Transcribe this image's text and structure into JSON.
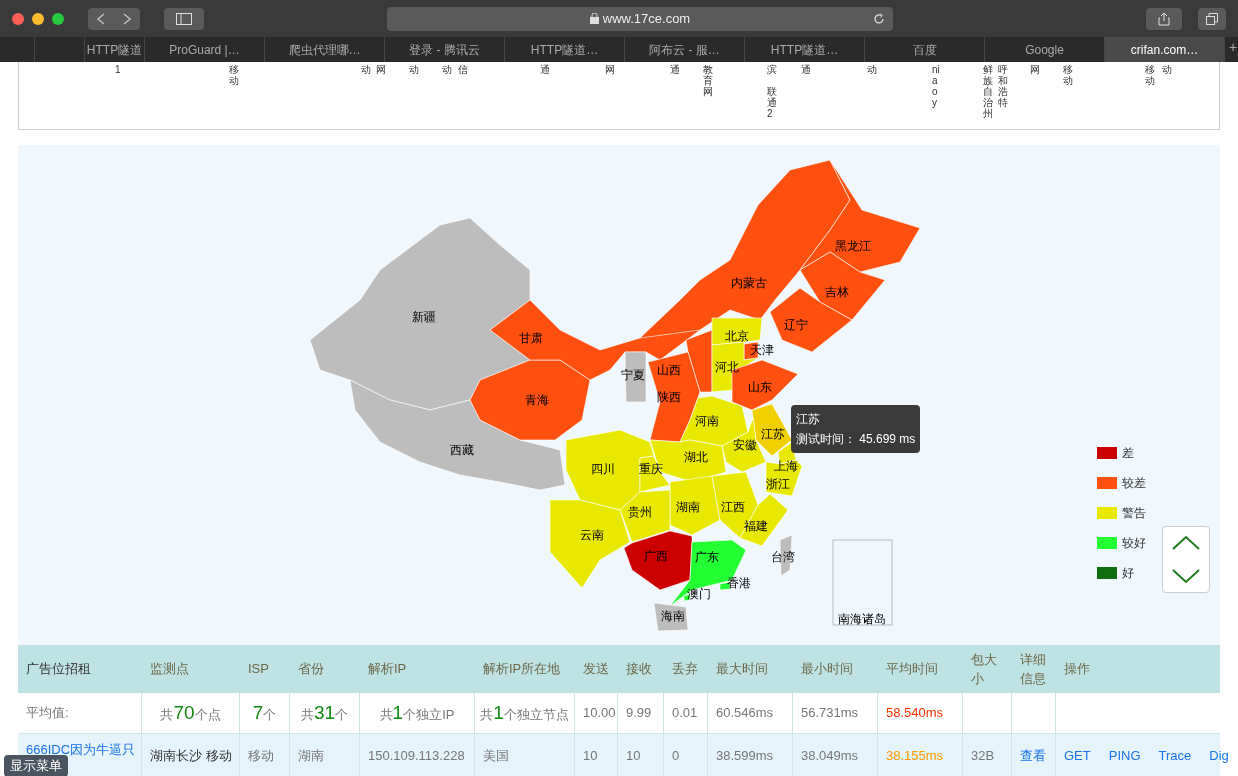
{
  "browser": {
    "url": "www.17ce.com",
    "tabs": [
      {
        "title": "HTTP隧道",
        "selected": false
      },
      {
        "title": "ProGuard |…",
        "selected": false
      },
      {
        "title": "爬虫代理哪…",
        "selected": false
      },
      {
        "title": "登录 - 腾讯云",
        "selected": false
      },
      {
        "title": "HTTP隧道…",
        "selected": false
      },
      {
        "title": "阿布云 - 服…",
        "selected": false
      },
      {
        "title": "HTTP隧道…",
        "selected": false
      },
      {
        "title": "百度",
        "selected": false
      },
      {
        "title": "Google",
        "selected": false
      },
      {
        "title": "crifan.com…",
        "selected": true
      }
    ],
    "new_tab": "+"
  },
  "header_strip": [
    "1",
    "移动",
    "动",
    "网",
    "动",
    "动",
    "信",
    "通",
    "网",
    "通",
    "教育网",
    "滨",
    "联通2",
    "通",
    "动",
    "niaoy",
    "鲜族自治州",
    "呼和浩特",
    "网",
    "移动",
    "移动",
    "动"
  ],
  "map": {
    "provinces": [
      {
        "name": "新疆",
        "color": "#bdbdbd"
      },
      {
        "name": "西藏",
        "color": "#bdbdbd"
      },
      {
        "name": "青海",
        "color": "#ff5010"
      },
      {
        "name": "甘肃",
        "color": "#ff5010"
      },
      {
        "name": "内蒙古",
        "color": "#ff5010"
      },
      {
        "name": "黑龙江",
        "color": "#ff5010"
      },
      {
        "name": "吉林",
        "color": "#ff5010"
      },
      {
        "name": "辽宁",
        "color": "#ff5010"
      },
      {
        "name": "宁夏",
        "color": "#bdbdbd"
      },
      {
        "name": "山西",
        "color": "#ff5010"
      },
      {
        "name": "陕西",
        "color": "#ff5010"
      },
      {
        "name": "北京",
        "color": "#e8e800"
      },
      {
        "name": "天津",
        "color": "#ff5010"
      },
      {
        "name": "河北",
        "color": "#e8e800"
      },
      {
        "name": "山东",
        "color": "#ff5010"
      },
      {
        "name": "河南",
        "color": "#e8e800"
      },
      {
        "name": "江苏",
        "color": "#f0d000"
      },
      {
        "name": "安徽",
        "color": "#e8e800"
      },
      {
        "name": "上海",
        "color": "#e8e800"
      },
      {
        "name": "湖北",
        "color": "#e8e800"
      },
      {
        "name": "四川",
        "color": "#e8e800"
      },
      {
        "name": "重庆",
        "color": "#e8e800"
      },
      {
        "name": "浙江",
        "color": "#e8e800"
      },
      {
        "name": "湖南",
        "color": "#e8e800"
      },
      {
        "name": "江西",
        "color": "#e8e800"
      },
      {
        "name": "贵州",
        "color": "#e8e800"
      },
      {
        "name": "福建",
        "color": "#e8e800"
      },
      {
        "name": "云南",
        "color": "#e8e800"
      },
      {
        "name": "广西",
        "color": "#cc0000"
      },
      {
        "name": "广东",
        "color": "#22ff33"
      },
      {
        "name": "香港",
        "color": "#22ff33"
      },
      {
        "name": "澳门",
        "color": "#22ff33"
      },
      {
        "name": "台湾",
        "color": "#bdbdbd"
      },
      {
        "name": "海南",
        "color": "#bdbdbd"
      }
    ],
    "inset_label": "南海诸岛",
    "tooltip": {
      "title": "江苏",
      "text": "测试时间： 45.699 ms"
    },
    "legend": [
      {
        "label": "差",
        "color": "#cc0000"
      },
      {
        "label": "较差",
        "color": "#ff5010"
      },
      {
        "label": "警告",
        "color": "#e8e800"
      },
      {
        "label": "较好",
        "color": "#22ff33"
      },
      {
        "label": "好",
        "color": "#0f6e0f"
      }
    ]
  },
  "table": {
    "columns": [
      "广告位招租",
      "监测点",
      "ISP",
      "省份",
      "解析IP",
      "解析IP所在地",
      "发送",
      "接收",
      "丢弃",
      "最大时间",
      "最小时间",
      "平均时间",
      "包大小",
      "详细信息",
      "操作"
    ],
    "average": {
      "label": "平均值:",
      "counts": [
        {
          "prefix": "共",
          "count": "70",
          "suffix": "个点"
        },
        {
          "count": "7",
          "suffix": "个"
        },
        {
          "prefix": "共",
          "count": "31",
          "suffix": "个"
        },
        {
          "prefix": "共",
          "count": "1",
          "suffix": "个独立IP"
        },
        {
          "prefix": "共",
          "count": "1",
          "suffix": "个独立节点"
        }
      ],
      "values": [
        "10.00",
        "9.99",
        "0.01",
        "60.546ms",
        "56.731ms"
      ],
      "avg_time": "58.540ms"
    },
    "rows": [
      {
        "sponsor": "666IDC因为牛逼只",
        "node": "湖南长沙 移动",
        "isp": "移动",
        "province": "湖南",
        "ip": "150.109.113.228",
        "ip_location": "美国",
        "values": [
          "10",
          "10",
          "0",
          "38.599ms",
          "38.049ms"
        ],
        "avg_time": "38.155ms",
        "size": "32B",
        "detail": "查看",
        "actions": [
          "GET",
          "PING",
          "Trace",
          "Dig"
        ]
      }
    ]
  },
  "float_menu": "显示菜单"
}
